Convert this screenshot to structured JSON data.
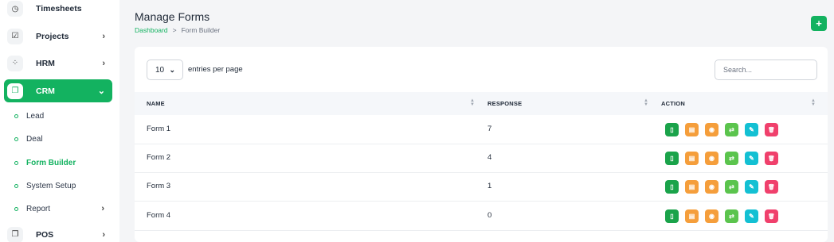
{
  "sidebar": {
    "items": [
      {
        "label": "Timesheets",
        "icon": "clock-icon",
        "glyph": "◷"
      },
      {
        "label": "Projects",
        "icon": "checkbox-icon",
        "glyph": "☑"
      },
      {
        "label": "HRM",
        "icon": "network-icon",
        "glyph": "⁘"
      },
      {
        "label": "CRM",
        "icon": "layers-icon",
        "glyph": "❐"
      }
    ],
    "crm_sub": [
      {
        "label": "Lead"
      },
      {
        "label": "Deal"
      },
      {
        "label": "Form Builder"
      },
      {
        "label": "System Setup"
      },
      {
        "label": "Report"
      }
    ],
    "pos": {
      "label": "POS",
      "icon": "layers-icon",
      "glyph": "❐"
    },
    "chevron_right": "›",
    "chevron_down": "⌄"
  },
  "header": {
    "title": "Manage Forms",
    "breadcrumb": {
      "home": "Dashboard",
      "separator": ">",
      "current": "Form Builder"
    },
    "add_button": "+"
  },
  "table": {
    "entries_value": "10",
    "entries_label": "entries per page",
    "search_placeholder": "Search...",
    "columns": {
      "name": "NAME",
      "response": "RESPONSE",
      "action": "ACTION"
    },
    "rows": [
      {
        "name": "Form 1",
        "response": "7"
      },
      {
        "name": "Form 2",
        "response": "4"
      },
      {
        "name": "Form 3",
        "response": "1"
      },
      {
        "name": "Form 4",
        "response": "0"
      }
    ],
    "action_buttons": [
      {
        "name": "view-form-button",
        "icon": "file-icon",
        "glyph": "▯",
        "color": "#1aa34a"
      },
      {
        "name": "responses-button",
        "icon": "table-icon",
        "glyph": "▤",
        "color": "#f59e3b"
      },
      {
        "name": "preview-button",
        "icon": "eye-icon",
        "glyph": "◉",
        "color": "#f59e3b"
      },
      {
        "name": "convert-button",
        "icon": "refresh-icon",
        "glyph": "⇄",
        "color": "#5bc44d"
      },
      {
        "name": "edit-button",
        "icon": "pencil-icon",
        "glyph": "✎",
        "color": "#13c0d3"
      },
      {
        "name": "delete-button",
        "icon": "trash-icon",
        "glyph": "🗑",
        "color": "#f0406c"
      }
    ]
  },
  "colors": {
    "accent": "#13b260"
  }
}
